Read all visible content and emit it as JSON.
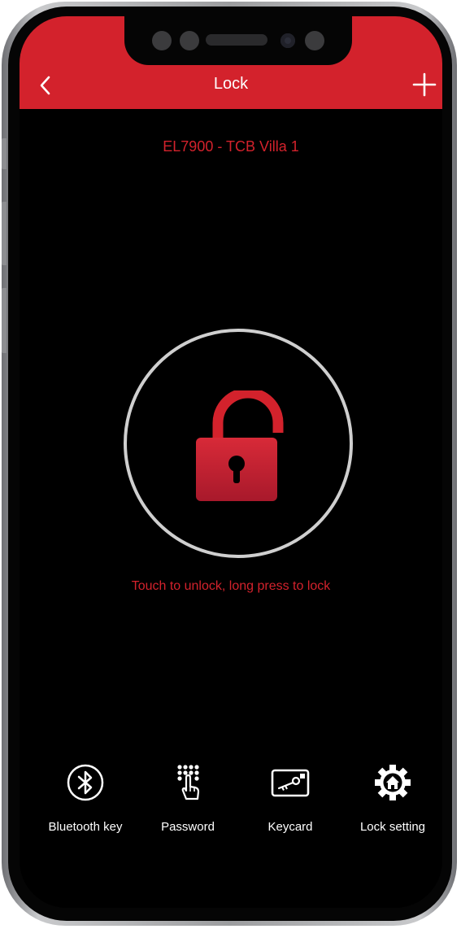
{
  "header": {
    "title": "Lock",
    "back_icon": "chevron-left-icon",
    "add_icon": "plus-icon",
    "color": "#d3222c"
  },
  "device": {
    "name": "EL7900 - TCB Villa 1"
  },
  "lock": {
    "state_icon": "padlock-open-icon",
    "hint": "Touch to unlock, long press to lock",
    "accent": "#c41e30"
  },
  "bottom_nav": [
    {
      "label": "Bluetooth key",
      "icon": "bluetooth-icon"
    },
    {
      "label": "Password",
      "icon": "keypad-icon"
    },
    {
      "label": "Keycard",
      "icon": "keycard-icon"
    },
    {
      "label": "Lock setting",
      "icon": "gear-home-icon"
    }
  ]
}
